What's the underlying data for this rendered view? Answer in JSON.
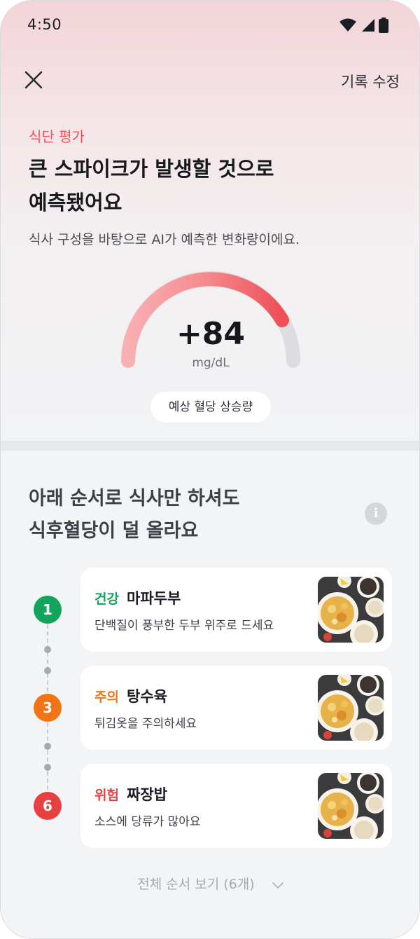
{
  "status_bar": {
    "time": "4:50"
  },
  "header": {
    "edit_label": "기록 수정"
  },
  "evaluation": {
    "label": "식단 평가",
    "headline_line1": "큰 스파이크가 발생할 것으로",
    "headline_line2": "예측됐어요",
    "subtext": "식사 구성을 바탕으로 AI가 예측한 변화량이에요.",
    "gauge_value": "+84",
    "gauge_unit": "mg/dL",
    "gauge_caption": "예상 혈당 상승량"
  },
  "order_section": {
    "title_line1": "아래 순서로 식사만 하셔도",
    "title_line2": "식후혈당이 덜 올라요",
    "info_icon": "i",
    "items": [
      {
        "step": "1",
        "tag": "건강",
        "name": "마파두부",
        "description": "단백질이 풍부한 두부 위주로 드세요",
        "tag_color": "#12a35d"
      },
      {
        "step": "3",
        "tag": "주의",
        "name": "탕수육",
        "description": "튀김옷을 주의하세요",
        "tag_color": "#f27414"
      },
      {
        "step": "6",
        "tag": "위험",
        "name": "짜장밥",
        "description": "소스에 당류가 많아요",
        "tag_color": "#e84040"
      }
    ],
    "view_all_label": "전체 순서 보기 (6개)"
  },
  "colors": {
    "accent_red": "#ef4e55",
    "healthy_green": "#12a35d",
    "caution_orange": "#f27414",
    "danger_red": "#e84040"
  },
  "icons": [
    "wifi-icon",
    "signal-icon",
    "battery-icon",
    "close-icon",
    "info-icon",
    "chevron-down-icon"
  ]
}
